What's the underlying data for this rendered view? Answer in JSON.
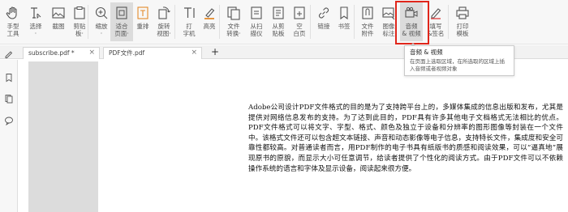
{
  "toolbar": {
    "tools": [
      {
        "id": "hand",
        "label": "手型\n工具",
        "icon": "hand-icon"
      },
      {
        "id": "select",
        "label": "选择\n·",
        "icon": "text-cursor-icon"
      },
      {
        "id": "screenshot",
        "label": "截图",
        "icon": "image-icon"
      },
      {
        "id": "clipboard",
        "label": "剪贴\n板·",
        "icon": "clipboard-icon"
      },
      {
        "id": "zoom",
        "label": "缩放\n·",
        "icon": "zoom-in-icon"
      },
      {
        "id": "fit-page",
        "label": "适合\n页面·",
        "icon": "fit-page-icon"
      },
      {
        "id": "reflow",
        "label": "重排",
        "icon": "reflow-icon"
      },
      {
        "id": "rotate-view",
        "label": "旋转\n视图·",
        "icon": "rotate-icon"
      },
      {
        "id": "typewriter",
        "label": "打\n字机",
        "icon": "typewriter-icon"
      },
      {
        "id": "highlight",
        "label": "高亮",
        "icon": "highlighter-icon"
      },
      {
        "id": "convert-file",
        "label": "文件\n转换·",
        "icon": "convert-file-icon"
      },
      {
        "id": "from-scanner",
        "label": "从扫\n描仪",
        "icon": "scanner-icon"
      },
      {
        "id": "from-clipboard",
        "label": "从剪\n贴板",
        "icon": "paste-icon"
      },
      {
        "id": "blank",
        "label": "空\n白页",
        "icon": "blank-page-icon"
      },
      {
        "id": "link",
        "label": "链接",
        "icon": "link-icon"
      },
      {
        "id": "bookmark",
        "label": "书签",
        "icon": "bookmark-icon"
      },
      {
        "id": "attachment",
        "label": "文件\n附件",
        "icon": "attachment-icon"
      },
      {
        "id": "image-annot",
        "label": "图像\n标注",
        "icon": "image-annotation-icon"
      },
      {
        "id": "audio-video",
        "label": "音频\n& 视频",
        "icon": "video-camera-icon"
      },
      {
        "id": "fill-sign",
        "label": "填写\n&签名",
        "icon": "pen-icon"
      },
      {
        "id": "print-template",
        "label": "打印\n模板",
        "icon": "printer-icon"
      }
    ]
  },
  "tooltip": {
    "title": "音频 & 视频",
    "description": "在页面上选取区域，在所选取的区域上插入音频或者视频对象"
  },
  "tabs": [
    {
      "label": "subscribe.pdf *",
      "close": "×"
    },
    {
      "label": "PDF文件.pdf",
      "close": "×"
    }
  ],
  "tab_add": "+",
  "document": {
    "paragraph": "Adobe公司设计PDF文件格式的目的是为了支持跨平台上的，多媒体集成的信息出版和发布，尤其是提供对网络信息发布的支持。为了达到此目的，PDF具有许多其他电子文档格式无法相比的优点。PDF文件格式可以将文字、字型、格式、颜色及独立于设备和分辨率的图形图像等封装在一个文件中。该格式文件还可以包含超文本链接、声音和动态影像等电子信息，支持特长文件，集成度和安全可靠性都较高。对普通读者而言，用PDF制作的电子书具有纸版书的质感和阅读效果，可以“逼真地”展现原书的原貌，而显示大小可任意调节，给读者提供了个性化的阅读方式。由于PDF文件可以不依赖操作系统的语言和字体及显示设备，阅读起来很方便。"
  },
  "colors": {
    "highlight_border": "#e0261b",
    "toolbar_bg": "#f7f7f7",
    "thumb_page": "#dcdcdc"
  }
}
